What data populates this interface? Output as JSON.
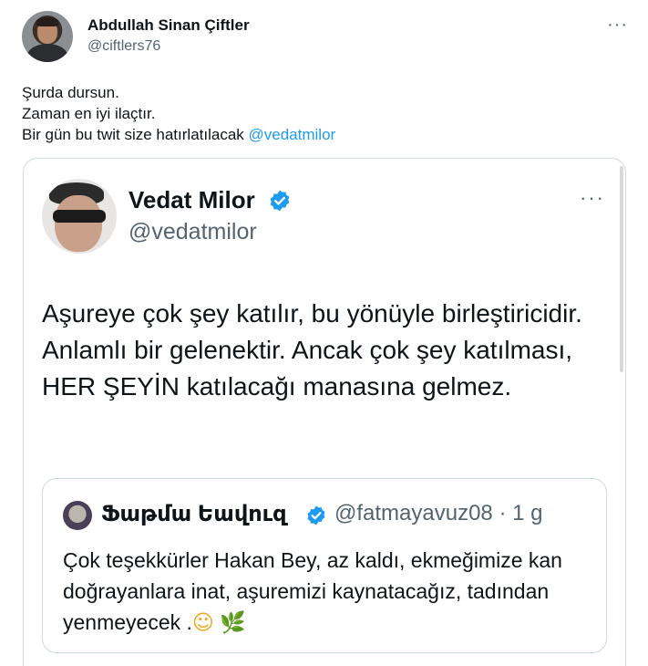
{
  "outer_tweet": {
    "author_name": "Abdullah Sinan Çiftler",
    "author_handle": "@ciftlers76",
    "more_label": "···",
    "text_lines": [
      "Şurda dursun.",
      "Zaman en iyi ilaçtır.",
      "Bir gün bu twit size hatırlatılacak "
    ],
    "mention": "@vedatmilor"
  },
  "quoted_tweet": {
    "author_name": "Vedat Milor",
    "author_handle": "@vedatmilor",
    "more_label": "···",
    "verified_icon": "verified-badge-icon",
    "text": "Aşureye çok şey katılır, bu yönüyle birleştiricidir. Anlamlı bir gelenektir. Ancak çok şey katılması, HER ŞEYİN katılacağı manasına gelmez."
  },
  "nested_tweet": {
    "author_name": "Ֆաթմա Եավուզ",
    "author_handle": "@fatmayavuz08 · 1 g",
    "text": "Çok teşekkürler Hakan Bey, az kaldı, ekmeğimize kan doğrayanlara inat, aşuremizi kaynatacağız, tadından yenmeyecek .",
    "emoji_1": "☺",
    "emoji_2": "🌿"
  },
  "colors": {
    "link": "#1d9bf0",
    "secondary_text": "#536471",
    "border": "#cfd9de",
    "verified": "#1d9bf0"
  }
}
